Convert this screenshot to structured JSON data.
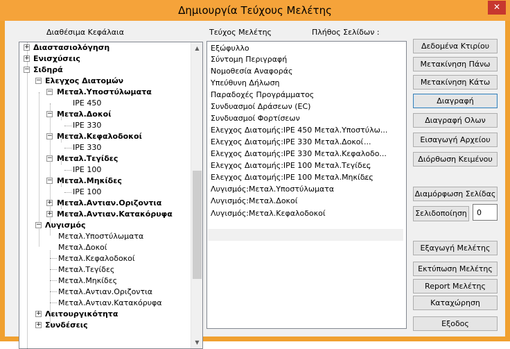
{
  "window": {
    "title": "Δημιουργία Τεύχους Μελέτης",
    "close_glyph": "✕"
  },
  "labels": {
    "available_chapters": "Διαθέσιμα Κεφάλαια",
    "study_volume": "Τεύχος Μελέτης",
    "page_count": "Πλήθος Σελίδων :"
  },
  "tree": {
    "items": [
      "Διαστασιολόγηση",
      "Ενισχύσεις",
      "Σιδηρά",
      "Ελεγχος Διατομών",
      "Μεταλ.Υποστύλωματα",
      "IPE 450",
      "Μεταλ.Δοκοί",
      "IPE 330",
      "Μεταλ.Κεφαλοδοκοί",
      "IPE 330",
      "Μεταλ.Τεγίδες",
      "IPE 100",
      "Μεταλ.Μηκίδες",
      "IPE 100",
      "Μεταλ.Αντιαν.Οριζοντια",
      "Μεταλ.Αντιαν.Κατακόρυφα",
      "Λυγισμός",
      "Μεταλ.Υποστύλωματα",
      "Μεταλ.Δοκοί",
      "Μεταλ.Κεφαλοδοκοί",
      "Μεταλ.Τεγίδες",
      "Μεταλ.Μηκίδες",
      "Μεταλ.Αντιαν.Οριζοντια",
      "Μεταλ.Αντιαν.Κατακόρυφα",
      "Λειτουργικότητα",
      "Συνδέσεις"
    ],
    "toggles": {
      "plus": "+",
      "minus": "−"
    },
    "scroll": {
      "up": "▲",
      "down": "▼"
    }
  },
  "study_list": {
    "items": [
      "Εξώφυλλο",
      "Σύντομη Περιγραφή",
      "Νομοθεσία Αναφοράς",
      "Υπεύθυνη Δήλωση",
      "Παραδοχές Προγράμματος",
      "Συνδυασμοί Δράσεων (EC)",
      "Συνδυασμοί Φορτίσεων",
      "Ελεγχος Διατομής:IPE 450 Μεταλ.Υποστύλω...",
      "Ελεγχος Διατομής:IPE 330 Μεταλ.Δοκοί",
      "Ελεγχος Διατομής:IPE 330 Μεταλ.Κεφαλοδο...",
      "Ελεγχος Διατομής:IPE 100 Μεταλ.Τεγίδες",
      "Ελεγχος Διατομής:IPE 100 Μεταλ.Μηκίδες",
      "Λυγισμός:Μεταλ.Υποστύλωματα",
      "Λυγισμός:Μεταλ.Δοκοί",
      "Λυγισμός:Μεταλ.Κεφαλοδοκοί"
    ],
    "ellipsis": "..."
  },
  "buttons": {
    "building_data": "Δεδομένα Κτιρίου",
    "move_up": "Μετακίνηση Πάνω",
    "move_down": "Μετακίνηση Κάτω",
    "delete": "Διαγραφή",
    "delete_all": "Διαγραφή Ολων",
    "import_file": "Εισαγωγή Αρχείου",
    "edit_text": "Διόρθωση Κειμένου",
    "page_setup": "Διαμόρφωση Σελίδας",
    "pagination": "Σελιδοποίηση",
    "export_study": "Εξαγωγή Μελέτης",
    "print_study": "Εκτύπωση Μελέτης",
    "report_study": "Report Μελέτης",
    "save": "Καταχώρηση",
    "exit": "Εξοδος"
  },
  "pagination": {
    "value": "0"
  }
}
